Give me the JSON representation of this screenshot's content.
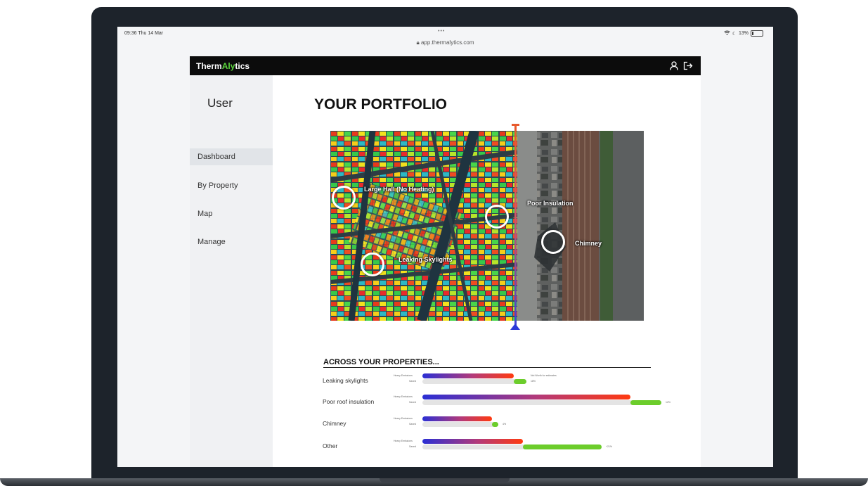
{
  "status_bar": {
    "time": "09:36  Thu 14 Mar",
    "dots": "•••",
    "url": "app.thermalytics.com",
    "battery": "13%"
  },
  "app": {
    "logo_part1": "Therm",
    "logo_highlight": "Aly",
    "logo_part2": "tics",
    "icons": [
      "user-icon",
      "logout-icon"
    ]
  },
  "sidebar": {
    "user_label": "User",
    "items": [
      {
        "label": "Dashboard",
        "active": true
      },
      {
        "label": "By Property",
        "active": false
      },
      {
        "label": "Map",
        "active": false
      },
      {
        "label": "Manage",
        "active": false
      }
    ]
  },
  "main": {
    "title": "YOUR PORTFOLIO",
    "callouts": [
      {
        "label": "Large Hall (No Heating)"
      },
      {
        "label": "Poor Insulation"
      },
      {
        "label": "Chimney"
      },
      {
        "label": "Leaking Skylights"
      }
    ]
  },
  "across": {
    "title": "ACROSS YOUR PROPERTIES...",
    "emission_caption": "Heavy Emissions",
    "saved_caption": "Saved",
    "rows": [
      {
        "label": "Leaking skylights",
        "emission_level": 0.29,
        "saved_level": 0.33,
        "saved_pct": "18%",
        "note": "Not Worth for estimates"
      },
      {
        "label": "Poor roof insulation",
        "emission_level": 0.66,
        "saved_level": 0.76,
        "saved_pct": "12%"
      },
      {
        "label": "Chimney",
        "emission_level": 0.22,
        "saved_level": 0.24,
        "saved_pct": "4%"
      },
      {
        "label": "Other",
        "emission_level": 0.32,
        "saved_level": 0.57,
        "saved_pct": "+21%"
      }
    ]
  },
  "colors": {
    "accent_green": "#5bd63c",
    "topbar": "#0c0c0c",
    "emission_start": "#2b2fd4",
    "emission_end": "#ff3a10",
    "saved_green": "#6ccd2b"
  }
}
